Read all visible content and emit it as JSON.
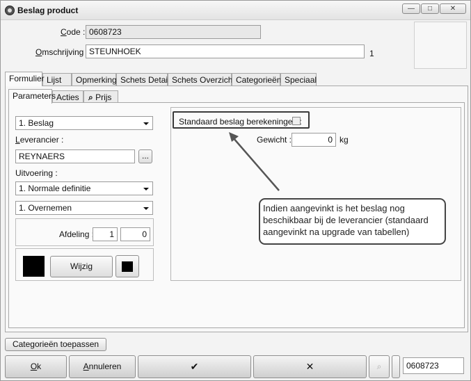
{
  "window": {
    "title": "Beslag product",
    "buttons": {
      "minimize": "—",
      "maximize": "□",
      "close": "✕"
    }
  },
  "form": {
    "code_label": "Code :",
    "code_value": "0608723",
    "omschrijving_label": "Omschrijving :",
    "omschrijving_value": "STEUNHOEK",
    "omschrijving_counter": "1"
  },
  "main_tabs": [
    "Formulier",
    "Lijst",
    "Opmerking",
    "Schets Detail",
    "Schets Overzicht",
    "Categorieën",
    "Speciaal"
  ],
  "sub_tabs": [
    "Parameters",
    "Acties",
    "Prijs"
  ],
  "left": {
    "type_select": "1.  Beslag",
    "leverancier_label": "Leverancier :",
    "leverancier_value": "REYNAERS",
    "browse_button": "...",
    "uitvoering_label": "Uitvoering :",
    "uitvoering_select": "1.  Normale definitie",
    "overnemen_select": "1.  Overnemen",
    "afdeling_label": "Afdeling :",
    "afdeling_value1": "1",
    "afdeling_value2": "0",
    "wijzig_button": "Wijzig"
  },
  "right": {
    "standaard_label": "Standaard beslag berekeningen :",
    "gewicht_label": "Gewicht :",
    "gewicht_value": "0",
    "gewicht_unit": "kg",
    "callout": "Indien aangevinkt is het beslag nog beschikbaar bij de leverancier (standaard aangevinkt na upgrade van tabellen)"
  },
  "footer": {
    "categorieen_button": "Categorieën toepassen",
    "ok_button": "Ok",
    "annuleren_button": "Annuleren",
    "confirm_icon": "✔",
    "cancel_icon": "✕",
    "footer_code": "0608723"
  },
  "colors": {
    "swatch": "#000000",
    "highlight_border": "#3a3a3a"
  }
}
